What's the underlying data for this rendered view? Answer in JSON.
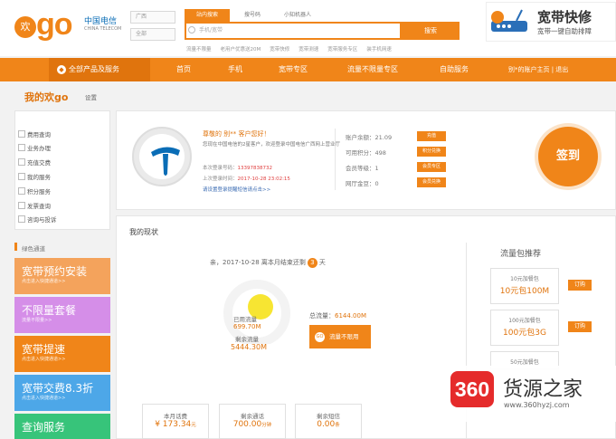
{
  "header": {
    "logo_mark": "欢",
    "logo_text": "go",
    "carrier_logo": "中国电信",
    "carrier_logo_en": "CHINA TELECOM",
    "province_select": "广西",
    "category_select": "全部",
    "search_tabs": [
      "站内搜索",
      "搜号码",
      "小知机器人"
    ],
    "search_placeholder": "手机/宽带",
    "search_button": "搜索",
    "hot_words": [
      "流量不限量",
      "老用户优惠送20M",
      "宽带快修",
      "宽带测速",
      "宽带服务专区",
      "装手机网速"
    ]
  },
  "promo": {
    "title": "宽带快修",
    "subtitle": "宽带一键自助排障"
  },
  "nav": {
    "all_products": "全部产品及服务",
    "items": [
      "首页",
      "手机",
      "宽带专区",
      "流量不限量专区",
      "自助服务"
    ],
    "user": "别*的账户主页 | 退出"
  },
  "sidebar": {
    "title": "我的欢go",
    "settings": "设置",
    "menu": [
      "费用查询",
      "业务办理",
      "充值交费",
      "我的服务",
      "积分服务",
      "发票查询",
      "咨询与投诉"
    ],
    "green_channel": "绿色通道",
    "banners": [
      {
        "title": "宽带预约安装",
        "sub": "点击进入快捷通道>>",
        "color": "#f4a35c"
      },
      {
        "title": "不限量套餐",
        "sub": "流量不限量>>",
        "color": "#d58ee8"
      },
      {
        "title": "宽带提速",
        "sub": "点击进入快捷通道>>",
        "color": "#f08519"
      },
      {
        "title": "宽带交费8.3折",
        "sub": "点击进入快捷通道>>",
        "color": "#4da7e8"
      },
      {
        "title": "查询服务",
        "sub": "",
        "color": "#37c47a"
      }
    ]
  },
  "account": {
    "greeting": "尊敬的 别** 客户您好！",
    "welcome": "您现在中国电信的2星客户，欢迎登录中国电信广西网上营业厅",
    "login_label": "本次登录号码：",
    "login_value": "13397838732",
    "last_login_label": "上次登录时间：",
    "last_login_value": "2017-10-28 23:02:15",
    "set_link": "请设置登录提醒短信请点击>>",
    "stats": [
      {
        "label": "账户余额：21.09",
        "button": "充值"
      },
      {
        "label": "可用积分：498",
        "button": "积分兑换"
      },
      {
        "label": "会员等级：1",
        "button": "会员专区"
      },
      {
        "label": "网厅金豆：0",
        "button": "会员兑换"
      }
    ],
    "signin": "签到"
  },
  "status": {
    "title": "我的现状",
    "date_prefix": "亲，2017-10-28 离本月结束还剩",
    "days_left": "3",
    "date_suffix": "天",
    "used_label": "已用流量",
    "used_value": "699.70M",
    "remain_label": "剩余流量",
    "remain_value": "5444.30M",
    "total_label": "总流量：",
    "total_value": "6144.00M",
    "unlimited_button": "流量不限用",
    "unlimited_icon": "GO"
  },
  "packages": {
    "title": "流量包推荐",
    "items": [
      {
        "small": "10元加餐包",
        "big": "10元包100M",
        "button": "订购"
      },
      {
        "small": "100元加餐包",
        "big": "100元包3G",
        "button": "订购"
      }
    ],
    "third_small": "50元加餐包"
  },
  "bottom": [
    {
      "label": "本月话费",
      "value": "¥ 173.34",
      "unit": "元"
    },
    {
      "label": "剩余通话",
      "value": "700.00",
      "unit": "分钟"
    },
    {
      "label": "剩余短信",
      "value": "0.00",
      "unit": "条"
    }
  ],
  "watermark": {
    "badge": "360",
    "text": "货源之家",
    "url": "www.360hyzj.com"
  }
}
